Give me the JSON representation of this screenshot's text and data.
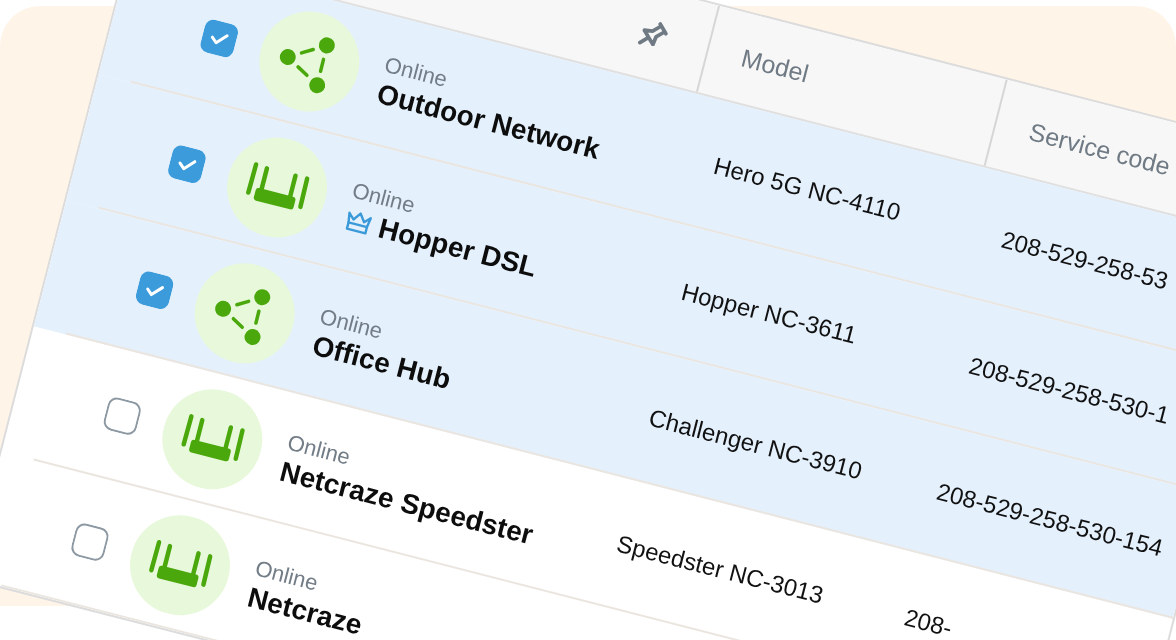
{
  "table": {
    "columns": [
      {
        "kind": "pin"
      },
      {
        "kind": "text",
        "label": "Model"
      },
      {
        "kind": "text",
        "label": "Service code"
      }
    ],
    "rows": [
      {
        "selected": true,
        "kind": "network",
        "crown": false,
        "status": "Online",
        "name": "Outdoor Network",
        "model": "Hero 5G NC-4110",
        "service_code": "208-529-258-53"
      },
      {
        "selected": true,
        "kind": "router",
        "crown": true,
        "status": "Online",
        "name": "Hopper DSL",
        "model": "Hopper NC-3611",
        "service_code": "208-529-258-530-1"
      },
      {
        "selected": true,
        "kind": "network",
        "crown": false,
        "status": "Online",
        "name": "Office Hub",
        "model": "Challenger NC-3910",
        "service_code": "208-529-258-530-154"
      },
      {
        "selected": false,
        "kind": "router",
        "crown": false,
        "status": "Online",
        "name": "Netcraze Speedster",
        "model": "Speedster NC-3013",
        "service_code": "208-"
      },
      {
        "selected": false,
        "kind": "router",
        "crown": false,
        "status": "Online",
        "name": "Netcraze"
      }
    ]
  }
}
